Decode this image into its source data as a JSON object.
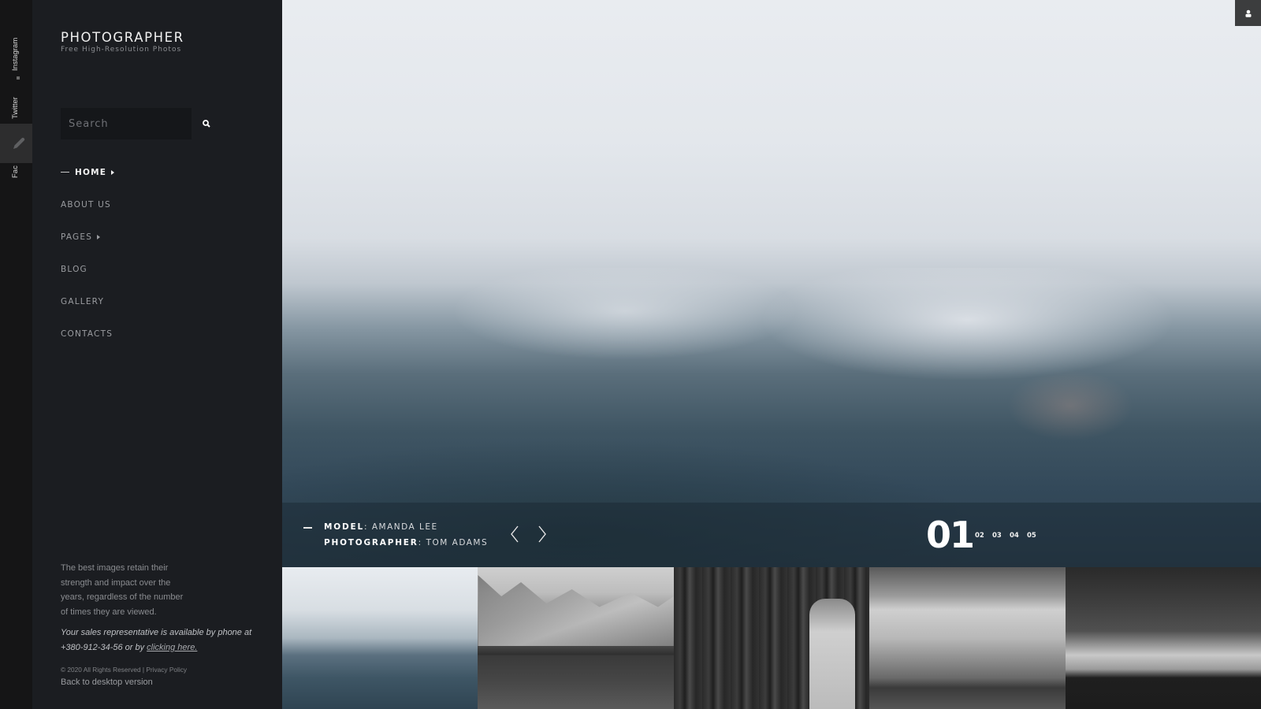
{
  "social": {
    "links": [
      "Instagram",
      "Twitter",
      "Facebook"
    ],
    "visible_labels": [
      "Instagram",
      "Twitter",
      "Fac"
    ],
    "edit_icon": "pencil-icon"
  },
  "brand": {
    "title": "PHOTOGRAPHER",
    "subtitle": "Free High-Resolution Photos"
  },
  "search": {
    "placeholder": "Search",
    "value": "",
    "icon": "search-icon"
  },
  "nav": {
    "items": [
      {
        "label": "HOME",
        "active": true,
        "has_submenu": true
      },
      {
        "label": "ABOUT US",
        "active": false,
        "has_submenu": false
      },
      {
        "label": "PAGES",
        "active": false,
        "has_submenu": true
      },
      {
        "label": "BLOG",
        "active": false,
        "has_submenu": false
      },
      {
        "label": "GALLERY",
        "active": false,
        "has_submenu": false
      },
      {
        "label": "CONTACTS",
        "active": false,
        "has_submenu": false
      }
    ]
  },
  "footer": {
    "about": "The best images retain their strength and impact over the years, regardless of the number of times they are viewed.",
    "sales_text": "Your sales representative is available by phone at +380-912-34-56 or by ",
    "sales_link": "clicking here.",
    "copyright": "© 2020 All Rights Reserved | ",
    "privacy": "Privacy Policy",
    "back_desktop": "Back to desktop version"
  },
  "hero": {
    "user_icon": "user-icon",
    "caption": {
      "model_label": "MODEL",
      "model_value": "AMANDA LEE",
      "photographer_label": "PHOTOGRAPHER",
      "photographer_value": "TOM ADAMS"
    },
    "slider": {
      "current": "01",
      "others": [
        "02",
        "03",
        "04",
        "05"
      ],
      "prev_icon": "chevron-left-icon",
      "next_icon": "chevron-right-icon"
    }
  },
  "thumbnails": [
    {
      "subject": "misty mountain (color)"
    },
    {
      "subject": "mountain lake reflection (b&w)"
    },
    {
      "subject": "woman in hat among trees (b&w)"
    },
    {
      "subject": "mountain fog and road (b&w)"
    },
    {
      "subject": "stormy sky over coast (b&w)"
    }
  ]
}
